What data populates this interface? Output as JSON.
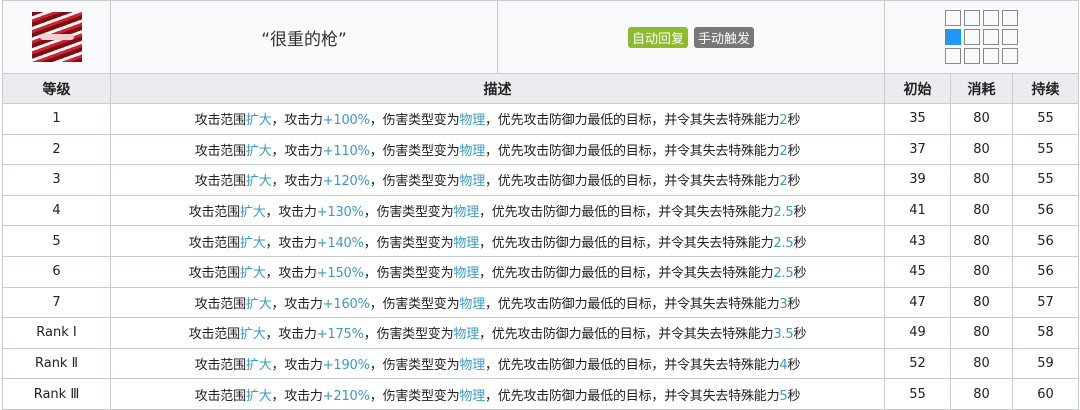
{
  "skill": {
    "name": "“很重的枪”",
    "icon": "skill-icon",
    "tags": [
      {
        "label": "自动回复",
        "color": "#8cbc2e"
      },
      {
        "label": "手动触发",
        "color": "#777777"
      }
    ],
    "range_grid": [
      [
        0,
        0,
        0,
        0
      ],
      [
        1,
        0,
        0,
        0
      ],
      [
        0,
        0,
        0,
        0
      ]
    ]
  },
  "headers": {
    "level": "等级",
    "desc": "描述",
    "initial": "初始",
    "cost": "消耗",
    "duration": "持续"
  },
  "rows": [
    {
      "level": "1",
      "atk": "+100%",
      "time": "2",
      "initial": "35",
      "cost": "80",
      "duration": "55"
    },
    {
      "level": "2",
      "atk": "+110%",
      "time": "2",
      "initial": "37",
      "cost": "80",
      "duration": "55"
    },
    {
      "level": "3",
      "atk": "+120%",
      "time": "2",
      "initial": "39",
      "cost": "80",
      "duration": "55"
    },
    {
      "level": "4",
      "atk": "+130%",
      "time": "2.5",
      "initial": "41",
      "cost": "80",
      "duration": "56"
    },
    {
      "level": "5",
      "atk": "+140%",
      "time": "2.5",
      "initial": "43",
      "cost": "80",
      "duration": "56"
    },
    {
      "level": "6",
      "atk": "+150%",
      "time": "2.5",
      "initial": "45",
      "cost": "80",
      "duration": "56"
    },
    {
      "level": "7",
      "atk": "+160%",
      "time": "3",
      "initial": "47",
      "cost": "80",
      "duration": "57"
    },
    {
      "level": "Rank Ⅰ",
      "atk": "+175%",
      "time": "3.5",
      "initial": "49",
      "cost": "80",
      "duration": "58"
    },
    {
      "level": "Rank Ⅱ",
      "atk": "+190%",
      "time": "4",
      "initial": "52",
      "cost": "80",
      "duration": "59"
    },
    {
      "level": "Rank Ⅲ",
      "atk": "+210%",
      "time": "5",
      "initial": "55",
      "cost": "80",
      "duration": "60"
    }
  ],
  "desc_parts": {
    "p1": "攻击范围",
    "h1": "扩大",
    "p2": "，攻击力",
    "p3": "，伤害类型变为",
    "h2": "物理",
    "p4": "，优先攻击防御力最低的目标，并令其失去特殊能力",
    "p5": "秒"
  }
}
